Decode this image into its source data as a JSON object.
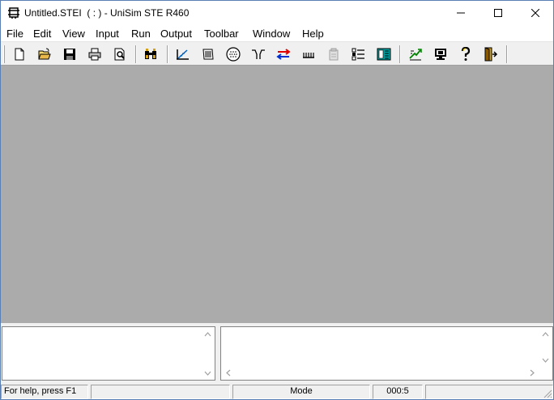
{
  "window": {
    "title": "Untitled.STEI  ( : ) - UniSim STE R460"
  },
  "menubar": {
    "items": [
      {
        "label": "File"
      },
      {
        "label": "Edit"
      },
      {
        "label": "View"
      },
      {
        "label": "Input"
      },
      {
        "label": "Run"
      },
      {
        "label": "Output"
      },
      {
        "label": "Toolbar"
      },
      {
        "label": "Window"
      },
      {
        "label": "Help"
      }
    ]
  },
  "toolbar": {
    "buttons": [
      {
        "icon": "new-document-icon"
      },
      {
        "icon": "open-folder-icon"
      },
      {
        "icon": "save-disk-icon"
      },
      {
        "icon": "print-icon"
      },
      {
        "icon": "print-preview-icon"
      },
      {
        "icon": "binoculars-icon"
      },
      {
        "icon": "geometry-input-icon"
      },
      {
        "icon": "tube-layout-icon"
      },
      {
        "icon": "tubesheet-circle-icon"
      },
      {
        "icon": "nozzle-icon"
      },
      {
        "icon": "exchange-arrows-icon"
      },
      {
        "icon": "baffle-comb-icon"
      },
      {
        "icon": "clipboard-disabled-icon"
      },
      {
        "icon": "list-options-icon"
      },
      {
        "icon": "results-table-icon"
      },
      {
        "icon": "run-calculation-icon"
      },
      {
        "icon": "monitor-icon"
      },
      {
        "icon": "help-question-icon"
      },
      {
        "icon": "exit-door-icon"
      }
    ]
  },
  "statusbar": {
    "help_text": "For help, press F1",
    "mode_text": "Mode",
    "counter_text": "000:5"
  },
  "colors": {
    "workspace": "#ababab",
    "chrome": "#f0f0f0"
  }
}
